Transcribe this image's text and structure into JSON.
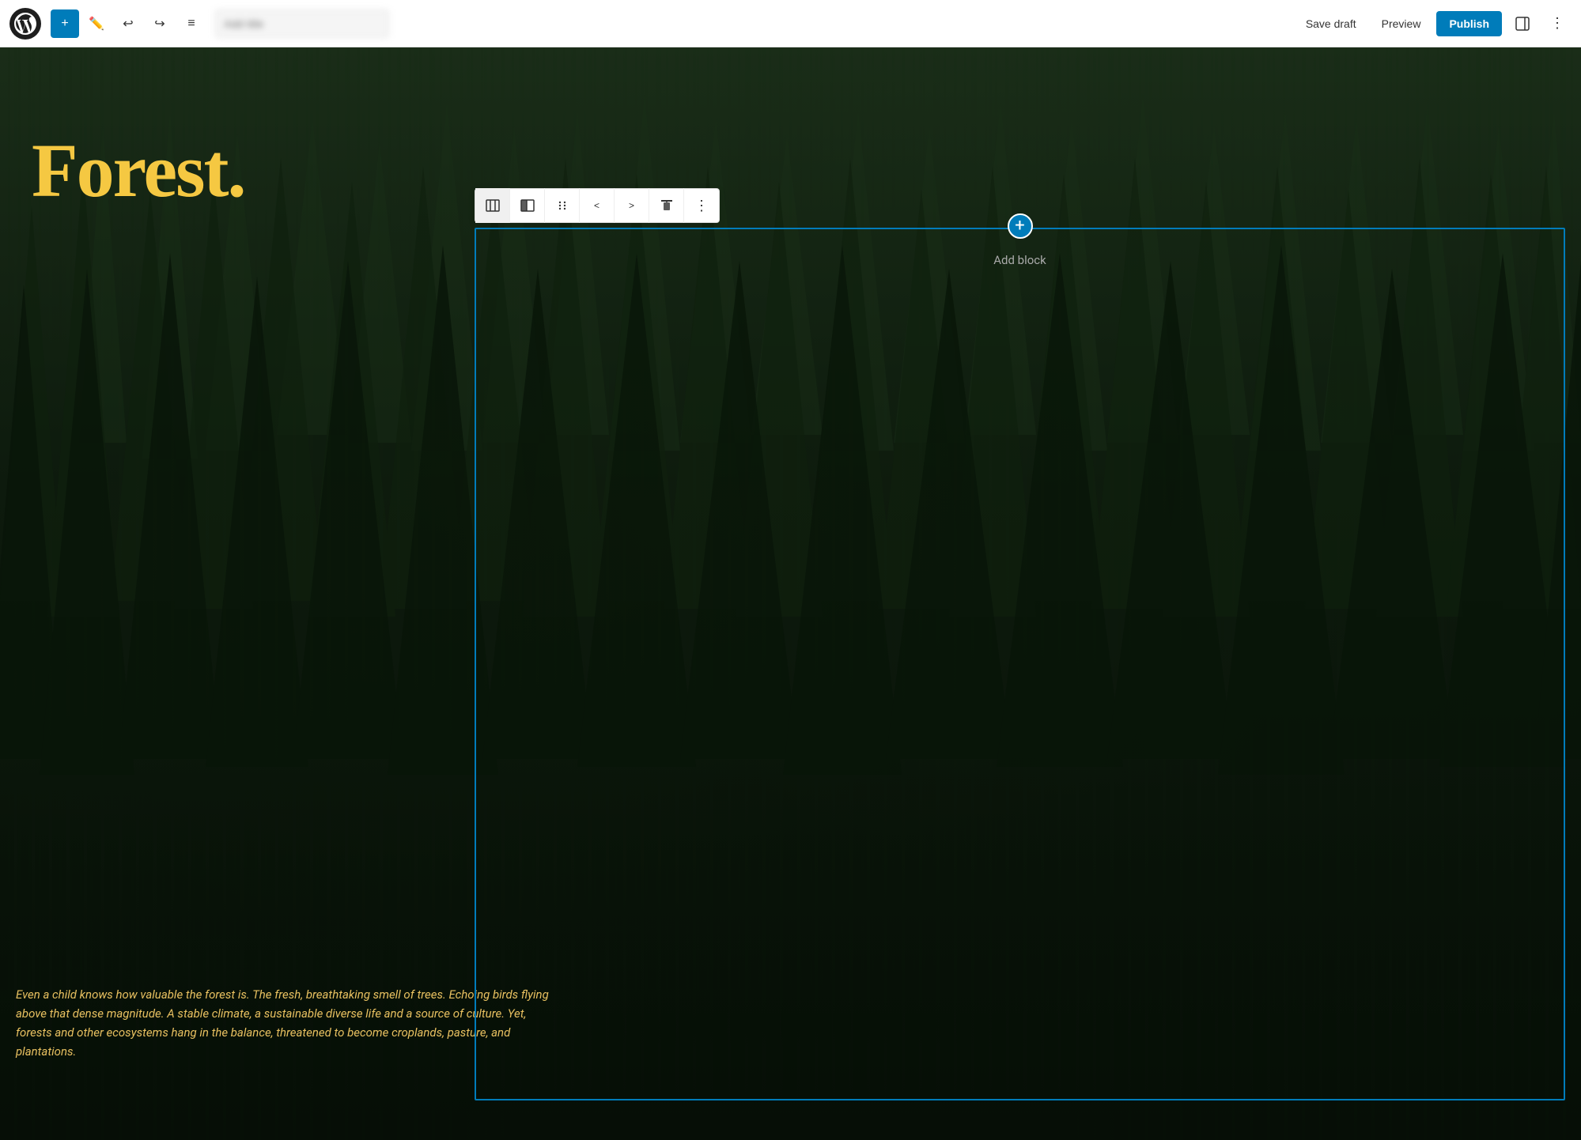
{
  "toolbar": {
    "add_label": "+",
    "save_draft_label": "Save draft",
    "preview_label": "Preview",
    "publish_label": "Publish",
    "post_title_placeholder": "Add title",
    "post_title_value": ""
  },
  "block_toolbar": {
    "buttons": [
      {
        "id": "columns-icon",
        "symbol": "⊞",
        "title": "Columns"
      },
      {
        "id": "two-col-icon",
        "symbol": "▐",
        "title": "Two columns"
      },
      {
        "id": "drag-icon",
        "symbol": "⠿",
        "title": "Drag"
      },
      {
        "id": "move-left-icon",
        "symbol": "<",
        "title": "Move left"
      },
      {
        "id": "move-right-icon",
        "symbol": ">",
        "title": "Move right"
      },
      {
        "id": "align-top-icon",
        "symbol": "⊤",
        "title": "Align top"
      },
      {
        "id": "more-options-icon",
        "symbol": "⋮",
        "title": "More options"
      }
    ]
  },
  "content": {
    "heading": "Forest.",
    "body_text": "Even a child knows how valuable the forest is. The fresh, breathtaking smell of trees. Echoing birds flying above that dense magnitude. A stable climate, a sustainable diverse life and a source of culture. Yet, forests and other ecosystems hang in the balance, threatened to become croplands, pasture, and plantations.",
    "add_block_label": "Add block"
  },
  "colors": {
    "heading": "#f5c842",
    "body_text": "#e8c060",
    "publish_bg": "#007cba",
    "selection_border": "#007cba",
    "add_btn_bg": "#007cba"
  }
}
